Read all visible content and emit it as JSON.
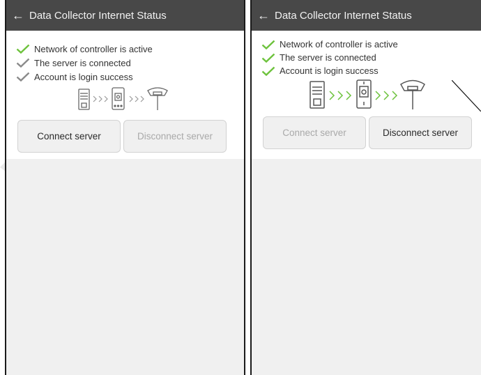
{
  "left_screen": {
    "title": "Data Collector Internet Status",
    "statuses": [
      {
        "label": "Network of controller is active",
        "state": "ok"
      },
      {
        "label": "The server is connected",
        "state": "pending"
      },
      {
        "label": "Account is login success",
        "state": "pending"
      }
    ],
    "connect_label": "Connect server",
    "disconnect_label": "Disconnect server"
  },
  "right_screen": {
    "title": "Data Collector Internet Status",
    "statuses": [
      {
        "label": "Network of controller is active",
        "state": "ok"
      },
      {
        "label": "The server is connected",
        "state": "ok"
      },
      {
        "label": "Account is login success",
        "state": "ok"
      }
    ],
    "connect_label": "Connect server",
    "disconnect_label": "Disconnect server"
  },
  "icons": [
    "back-arrow-icon",
    "check-icon",
    "server-icon",
    "controller-icon",
    "gnss-receiver-icon",
    "chevron-right-icon"
  ],
  "colors": {
    "titlebar": "#484848",
    "check_ok": "#6dc23c",
    "check_pending": "#8a8a8a",
    "chevron_active": "#6dc23c",
    "chevron_inactive": "#9a9a9a",
    "lower_background": "#f0f0f0",
    "watermark": "#e0202a"
  }
}
